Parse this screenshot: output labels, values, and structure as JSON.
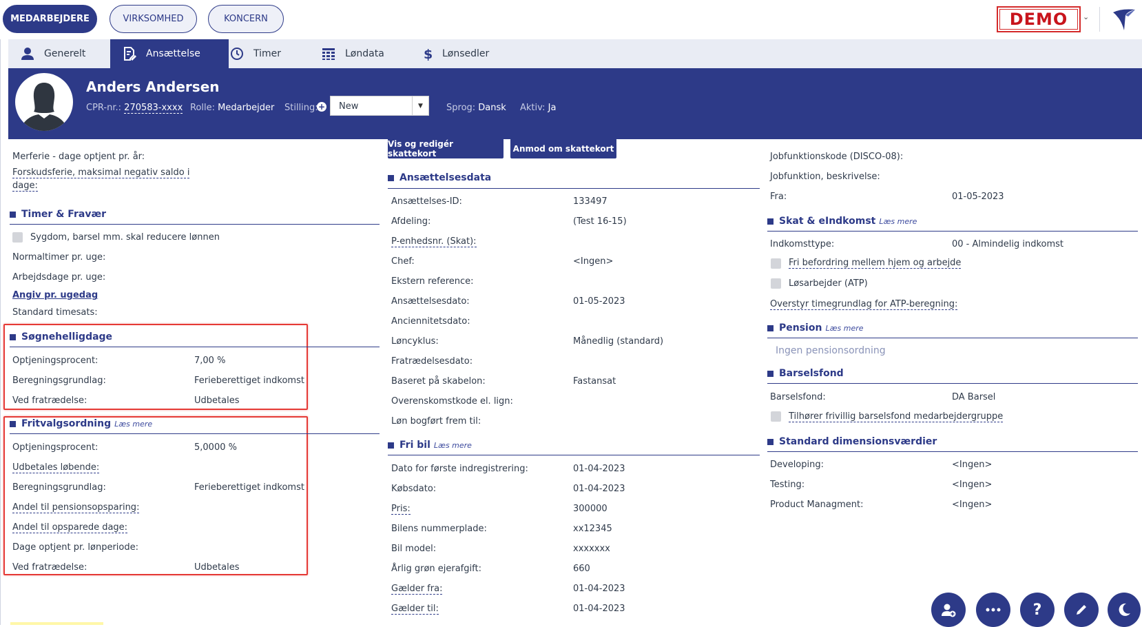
{
  "topnav": {
    "medarbejdere": "MEDARBEJDERE",
    "virksomhed": "VIRKSOMHED",
    "koncern": "KONCERN",
    "demo": "DEMO"
  },
  "tabs": {
    "generelt": "Generelt",
    "ansaettelse": "Ansættelse",
    "timer": "Timer",
    "loendata": "Løndata",
    "loensedler": "Lønsedler"
  },
  "profile": {
    "name": "Anders Andersen",
    "cpr_label": "CPR-nr.:",
    "cpr": "270583-xxxx",
    "rolle_label": "Rolle:",
    "rolle": "Medarbejder",
    "stilling_label": "Stilling:",
    "stilling": "New",
    "sprog_label": "Sprog:",
    "sprog": "Dansk",
    "aktiv_label": "Aktiv:",
    "aktiv": "Ja"
  },
  "left": {
    "merferie": "Merferie - dage optjent pr. år:",
    "forskud1": "Forskudsferie, maksimal negativ saldo i",
    "forskud2": "dage:",
    "timer_title": "Timer & Fravær",
    "sygdom": "Sygdom, barsel mm. skal reducere lønnen",
    "normaltimer": "Normaltimer pr. uge:",
    "arbejdsdage": "Arbejdsdage pr. uge:",
    "angiv": "Angiv pr. ugedag",
    "timesats": "Standard timesats:",
    "soegne_title": "Søgnehelligdage",
    "s_optj_label": "Optjeningsprocent:",
    "s_optj": "7,00 %",
    "s_beregn_label": "Beregningsgrundlag:",
    "s_beregn": "Ferieberettiget indkomst",
    "s_fratr_label": "Ved fratrædelse:",
    "s_fratr": "Udbetales",
    "fritvalg_title": "Fritvalgsordning",
    "fritvalg_more": "Læs mere",
    "f_optj_label": "Optjeningsprocent:",
    "f_optj": "5,0000 %",
    "f_udbet": "Udbetales løbende:",
    "f_beregn_label": "Beregningsgrundlag:",
    "f_beregn": "Ferieberettiget indkomst",
    "f_pension": "Andel til pensionsopsparing:",
    "f_opsparede": "Andel til opsparede dage:",
    "f_dage": "Dage optjent pr. lønperiode:",
    "f_fratr_label": "Ved fratrædelse:",
    "f_fratr": "Udbetales"
  },
  "mid": {
    "btn_vis": "Vis og redigér skattekort",
    "btn_anmod": "Anmod om skattekort",
    "ans_title": "Ansættelsesdata",
    "rows": [
      {
        "label": "Ansættelses-ID:",
        "value": "133497"
      },
      {
        "label": "Afdeling:",
        "value": "(Test 16-15)"
      },
      {
        "label": "P-enhedsnr. (Skat):",
        "value": ""
      },
      {
        "label": "Chef:",
        "value": "<Ingen>"
      },
      {
        "label": "Ekstern reference:",
        "value": ""
      },
      {
        "label": "Ansættelsesdato:",
        "value": "01-05-2023"
      },
      {
        "label": "Anciennitetsdato:",
        "value": ""
      },
      {
        "label": "Løncyklus:",
        "value": "Månedlig (standard)"
      },
      {
        "label": "Fratrædelsesdato:",
        "value": ""
      },
      {
        "label": "Baseret på skabelon:",
        "value": "Fastansat"
      },
      {
        "label": "Overenskomstkode el. lign:",
        "value": ""
      },
      {
        "label": "Løn bogført frem til:",
        "value": ""
      }
    ],
    "bil_title": "Fri bil",
    "bil_more": "Læs mere",
    "bil_rows": [
      {
        "label": "Dato for første indregistrering:",
        "value": "01-04-2023"
      },
      {
        "label": "Købsdato:",
        "value": "01-04-2023"
      },
      {
        "label": "Pris:",
        "value": "300000"
      },
      {
        "label": "Bilens nummerplade:",
        "value": "xx12345"
      },
      {
        "label": "Bil model:",
        "value": "xxxxxxx"
      },
      {
        "label": "Årlig grøn ejerafgift:",
        "value": "660"
      },
      {
        "label": "Gælder fra:",
        "value": "01-04-2023"
      },
      {
        "label": "Gælder til:",
        "value": "01-04-2023"
      }
    ]
  },
  "right": {
    "disco": "Jobfunktionskode (DISCO-08):",
    "jobbeskr": "Jobfunktion, beskrivelse:",
    "fra_label": "Fra:",
    "fra": "01-05-2023",
    "skat_title": "Skat & eIndkomst",
    "skat_more": "Læs mere",
    "indkomst_label": "Indkomsttype:",
    "indkomst": "00 - Almindelig indkomst",
    "befordring": "Fri befordring mellem hjem og arbejde",
    "loesarbejder": "Løsarbejder (ATP)",
    "atp": "Overstyr timegrundlag for ATP-beregning:",
    "pension_title": "Pension",
    "pension_more": "Læs mere",
    "pension_none": "Ingen pensionsordning",
    "barsel_title": "Barselsfond",
    "barsel_label": "Barselsfond:",
    "barsel": "DA Barsel",
    "barsel_frivillig": "Tilhører frivillig barselsfond medarbejdergruppe",
    "dim_title": "Standard dimensionsværdier",
    "developing_label": "Developing:",
    "developing": "<Ingen>",
    "testing_label": "Testing:",
    "testing": "<Ingen>",
    "product_label": "Product Managment:",
    "product": "<Ingen>"
  }
}
